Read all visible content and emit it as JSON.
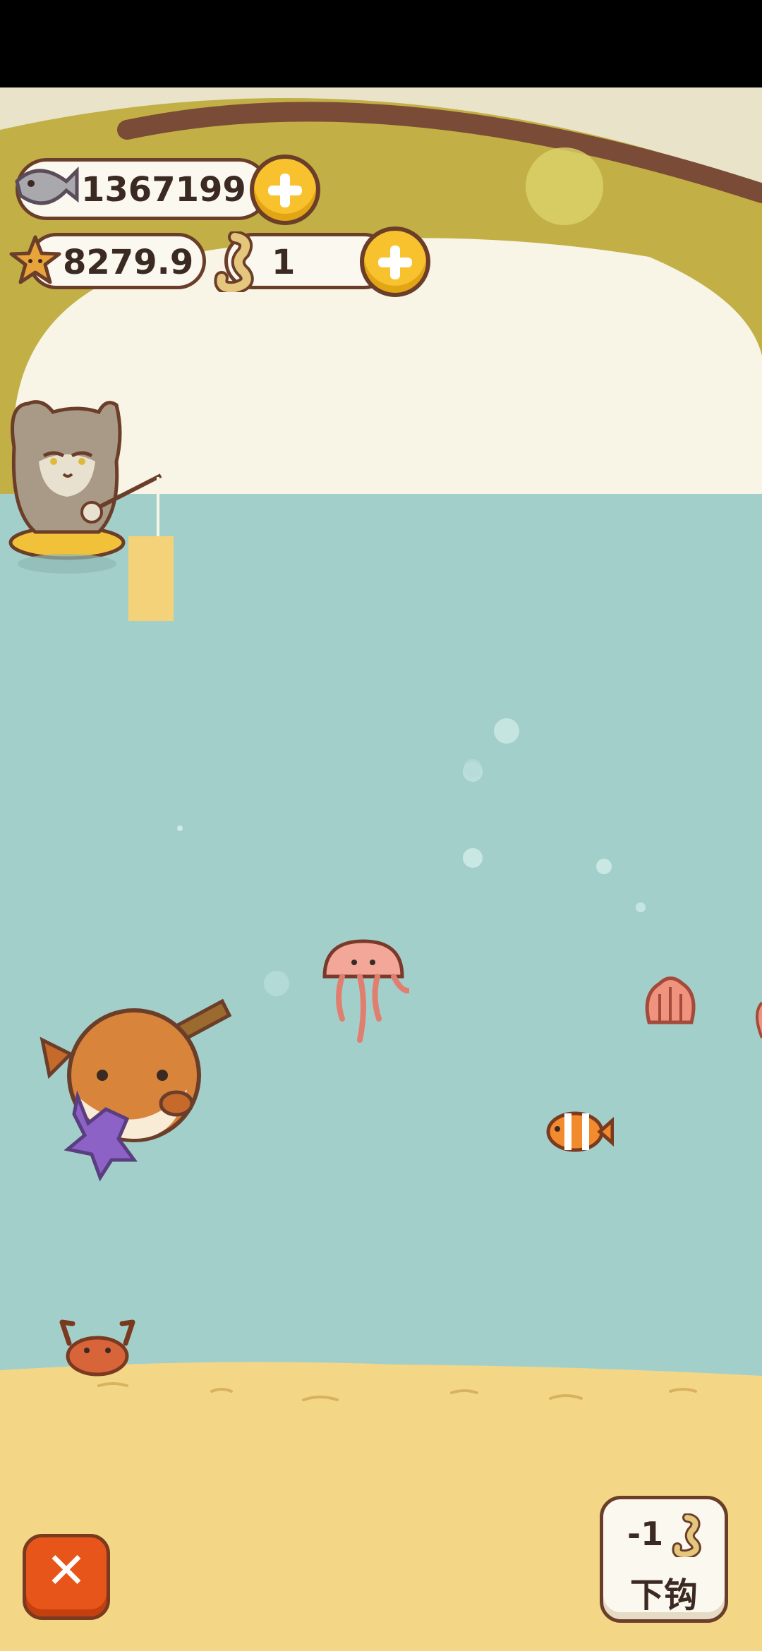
{
  "hud": {
    "fish_count": "1367199",
    "star_count": "8279.9",
    "bait_count": "1"
  },
  "icons": {
    "fish": "fish-icon",
    "star": "star-icon",
    "bait": "bait-worm-icon",
    "add": "plus-icon",
    "close": "close-icon"
  },
  "actions": {
    "close_label": "✕",
    "hook_cost": "-1",
    "hook_label": "下钩"
  },
  "colors": {
    "water": "#a3cfca",
    "sand": "#f3d786",
    "sky_olive": "#c4b24a",
    "button_yellow": "#f7c22d",
    "close_orange": "#e8551a",
    "outline_brown": "#6b3e2a"
  }
}
